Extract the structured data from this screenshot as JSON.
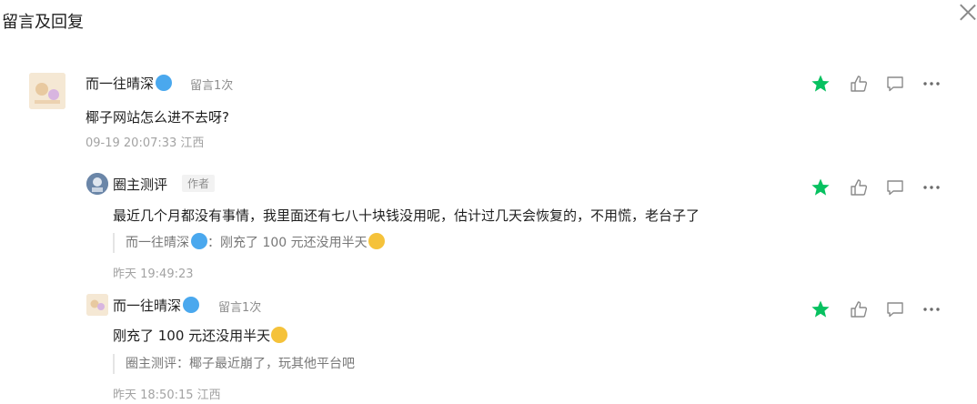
{
  "header": {
    "title": "留言及回复"
  },
  "comments": [
    {
      "name": "而一往晴深",
      "badge": "留言1次",
      "text": "椰子网站怎么进不去呀?",
      "meta": "09-19 20:07:33 江西"
    },
    {
      "name": "圈主测评",
      "author_tag": "作者",
      "text": "最近几个月都没有事情，我里面还有七八十块钱没用呢，估计过几天会恢复的，不用慌，老台子了",
      "quote": "而一往晴深",
      "quote_sep": "：",
      "quote_text": "刚充了 100 元还没用半天",
      "meta": "昨天 19:49:23"
    },
    {
      "name": "而一往晴深",
      "badge": "留言1次",
      "text": "刚充了 100 元还没用半天",
      "quote": "圈主测评：椰子最近崩了，玩其他平台吧",
      "meta": "昨天 18:50:15 江西"
    }
  ],
  "colors": {
    "star": "#07c160",
    "icon": "#8a8a8a"
  },
  "icons": [
    "star-icon",
    "thumbs-up-icon",
    "reply-icon",
    "more-icon",
    "close-icon"
  ]
}
